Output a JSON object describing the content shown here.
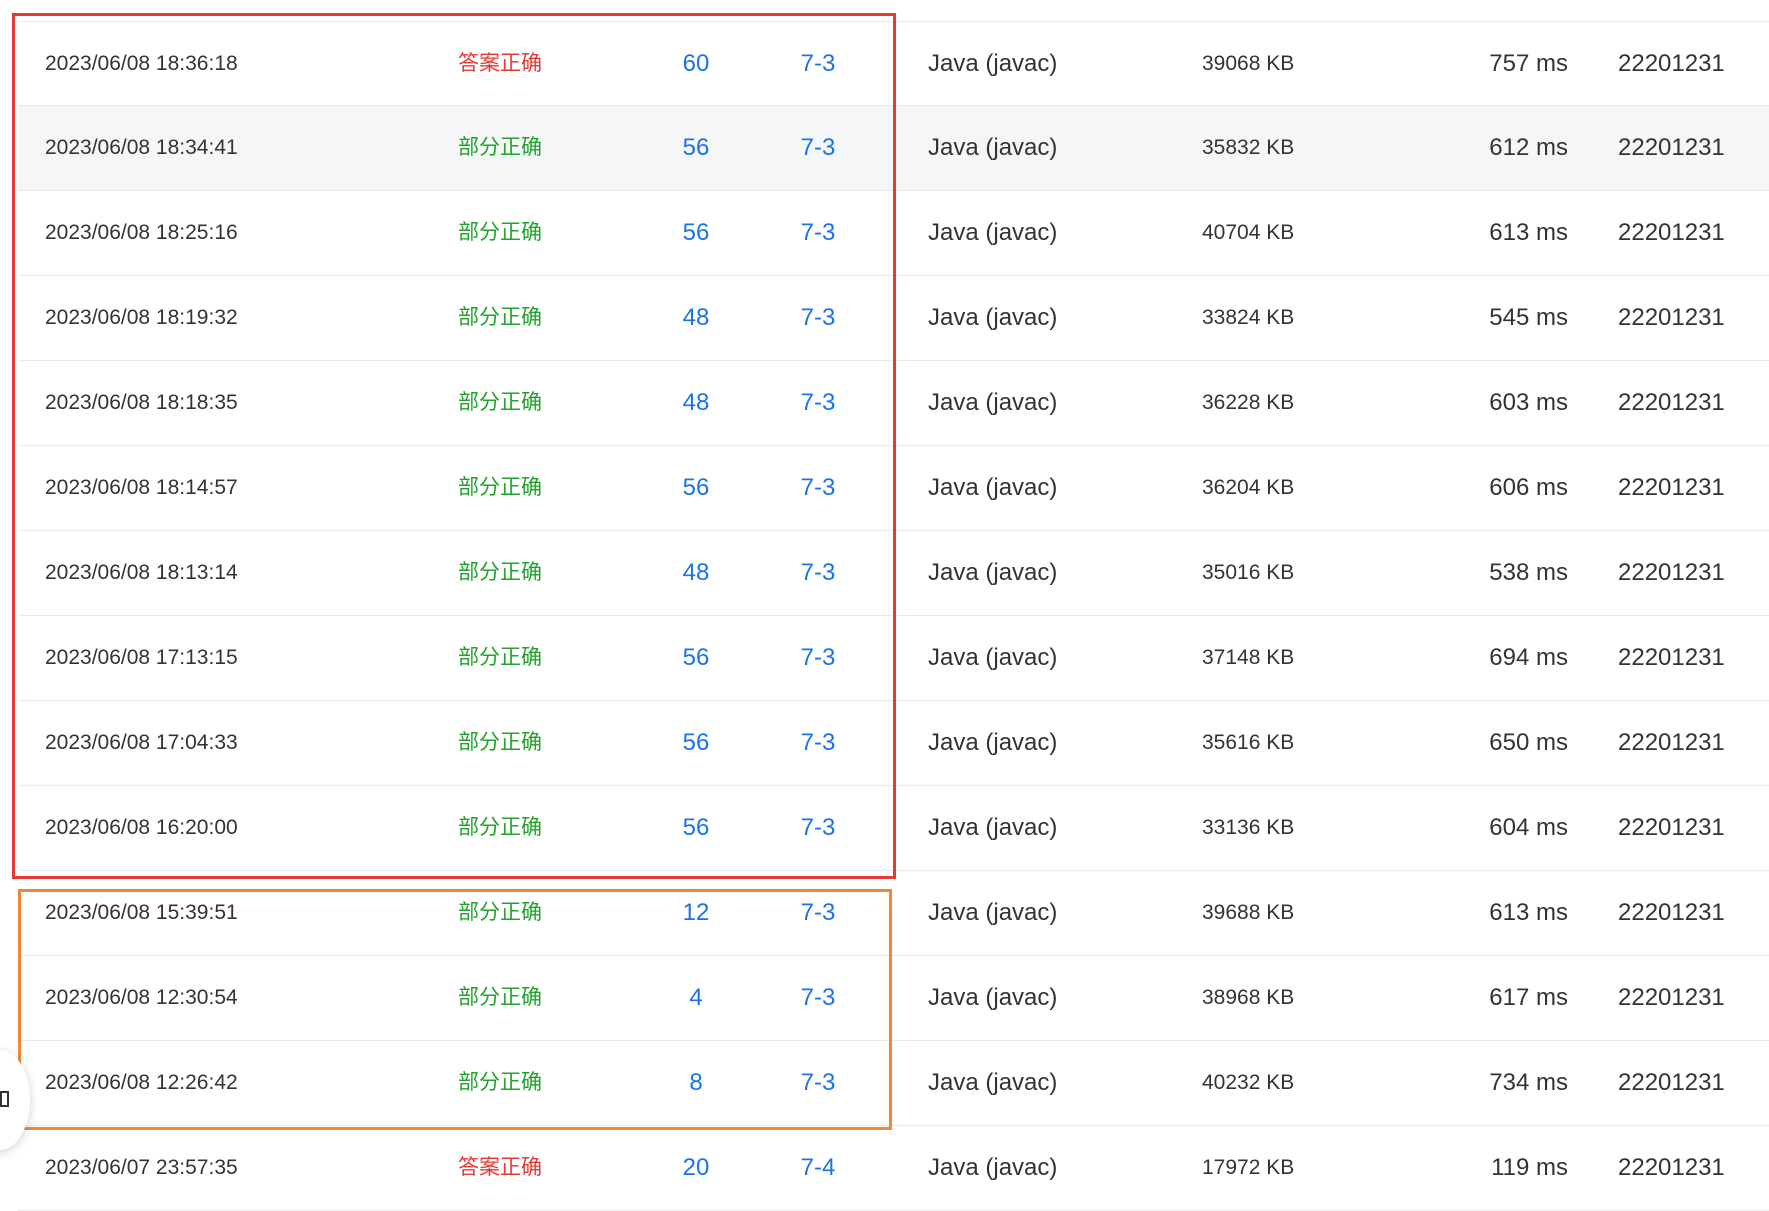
{
  "colors": {
    "accepted": "#e53935",
    "partial": "#21a32b",
    "link": "#1a73e8",
    "highlight_red": "#e53935",
    "highlight_orange": "#f0883a"
  },
  "submissions": [
    {
      "time": "2023/06/08 18:36:18",
      "status": "答案正确",
      "status_type": "accepted",
      "score": "60",
      "problem": "7-3",
      "language": "Java (javac)",
      "memory": "39068 KB",
      "runtime": "757 ms",
      "user": "22201231"
    },
    {
      "time": "2023/06/08 18:34:41",
      "status": "部分正确",
      "status_type": "partial",
      "score": "56",
      "problem": "7-3",
      "language": "Java (javac)",
      "memory": "35832 KB",
      "runtime": "612 ms",
      "user": "22201231"
    },
    {
      "time": "2023/06/08 18:25:16",
      "status": "部分正确",
      "status_type": "partial",
      "score": "56",
      "problem": "7-3",
      "language": "Java (javac)",
      "memory": "40704 KB",
      "runtime": "613 ms",
      "user": "22201231"
    },
    {
      "time": "2023/06/08 18:19:32",
      "status": "部分正确",
      "status_type": "partial",
      "score": "48",
      "problem": "7-3",
      "language": "Java (javac)",
      "memory": "33824 KB",
      "runtime": "545 ms",
      "user": "22201231"
    },
    {
      "time": "2023/06/08 18:18:35",
      "status": "部分正确",
      "status_type": "partial",
      "score": "48",
      "problem": "7-3",
      "language": "Java (javac)",
      "memory": "36228 KB",
      "runtime": "603 ms",
      "user": "22201231"
    },
    {
      "time": "2023/06/08 18:14:57",
      "status": "部分正确",
      "status_type": "partial",
      "score": "56",
      "problem": "7-3",
      "language": "Java (javac)",
      "memory": "36204 KB",
      "runtime": "606 ms",
      "user": "22201231"
    },
    {
      "time": "2023/06/08 18:13:14",
      "status": "部分正确",
      "status_type": "partial",
      "score": "48",
      "problem": "7-3",
      "language": "Java (javac)",
      "memory": "35016 KB",
      "runtime": "538 ms",
      "user": "22201231"
    },
    {
      "time": "2023/06/08 17:13:15",
      "status": "部分正确",
      "status_type": "partial",
      "score": "56",
      "problem": "7-3",
      "language": "Java (javac)",
      "memory": "37148 KB",
      "runtime": "694 ms",
      "user": "22201231"
    },
    {
      "time": "2023/06/08 17:04:33",
      "status": "部分正确",
      "status_type": "partial",
      "score": "56",
      "problem": "7-3",
      "language": "Java (javac)",
      "memory": "35616 KB",
      "runtime": "650 ms",
      "user": "22201231"
    },
    {
      "time": "2023/06/08 16:20:00",
      "status": "部分正确",
      "status_type": "partial",
      "score": "56",
      "problem": "7-3",
      "language": "Java (javac)",
      "memory": "33136 KB",
      "runtime": "604 ms",
      "user": "22201231"
    },
    {
      "time": "2023/06/08 15:39:51",
      "status": "部分正确",
      "status_type": "partial",
      "score": "12",
      "problem": "7-3",
      "language": "Java (javac)",
      "memory": "39688 KB",
      "runtime": "613 ms",
      "user": "22201231"
    },
    {
      "time": "2023/06/08 12:30:54",
      "status": "部分正确",
      "status_type": "partial",
      "score": "4",
      "problem": "7-3",
      "language": "Java (javac)",
      "memory": "38968 KB",
      "runtime": "617 ms",
      "user": "22201231"
    },
    {
      "time": "2023/06/08 12:26:42",
      "status": "部分正确",
      "status_type": "partial",
      "score": "8",
      "problem": "7-3",
      "language": "Java (javac)",
      "memory": "40232 KB",
      "runtime": "734 ms",
      "user": "22201231"
    },
    {
      "time": "2023/06/07 23:57:35",
      "status": "答案正确",
      "status_type": "accepted",
      "score": "20",
      "problem": "7-4",
      "language": "Java (javac)",
      "memory": "17972 KB",
      "runtime": "119 ms",
      "user": "22201231"
    }
  ]
}
